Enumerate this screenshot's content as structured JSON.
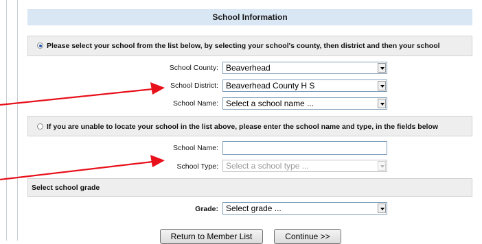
{
  "header": {
    "title": "School Information"
  },
  "option_select": {
    "text": "Please select your school from the list below, by selecting your school's county, then district and then your school",
    "checked": true
  },
  "fields_select": {
    "county_label": "School County:",
    "county_value": "Beaverhead",
    "district_label": "School District:",
    "district_value": "Beaverhead County H S",
    "name_label": "School Name:",
    "name_value": "Select a school name ..."
  },
  "option_manual": {
    "text": "If you are unable to locate your school in the list above, please enter the school name and type, in the fields below",
    "checked": false
  },
  "fields_manual": {
    "name_label": "School Name:",
    "name_value": "",
    "type_label": "School Type:",
    "type_value": "Select a school type ..."
  },
  "grade_section": {
    "title": "Select school grade",
    "grade_label": "Grade:",
    "grade_value": "Select grade ..."
  },
  "buttons": {
    "return_label": "Return to Member List",
    "continue_label": "Continue >>"
  },
  "colors": {
    "header_bg": "#d9e7f5",
    "section_bg": "#eeeeee",
    "annotation_arrow": "#e8101a"
  }
}
